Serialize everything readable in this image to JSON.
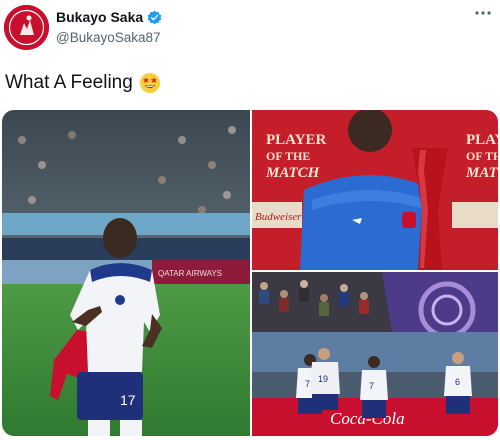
{
  "tweet": {
    "display_name": "Bukayo Saka",
    "handle": "@BukayoSaka87",
    "text": "What A Feeling",
    "verified": true
  },
  "media": {
    "photo_1": {
      "description_icon": "player-celebrating-photo",
      "shirt_number": "17",
      "board_text": "QATAR AIRWAYS"
    },
    "photo_2": {
      "banner_line1": "PLAYER",
      "banner_line2": "OF THE",
      "banner_line3": "MATCH",
      "sponsor": "Budweiser",
      "right_line1": "PLAY",
      "right_line2": "OF TH",
      "right_line3": "MATC"
    },
    "photo_3": {
      "sponsor": "Coca-Cola",
      "numbers": [
        "7",
        "19",
        "7",
        "6"
      ]
    }
  },
  "colors": {
    "brand_red": "#c8102e",
    "verified_blue": "#1d9bf0",
    "pitch_green": "#3f8a3a",
    "potm_red": "#c41e2a"
  }
}
